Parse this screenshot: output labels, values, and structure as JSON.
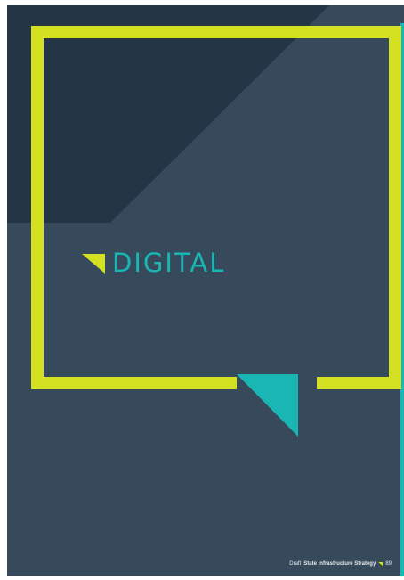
{
  "cover": {
    "section_title": "DIGITAL",
    "colors": {
      "background": "#364a5b",
      "dark_panel": "#243546",
      "frame": "#d4e022",
      "accent": "#19b6b4",
      "edge_strip": "#19b6b4"
    }
  },
  "footer": {
    "prefix": "Draft",
    "document_title": "State Infrastructure Strategy",
    "page_number": "89"
  },
  "icons": {
    "heading_marker": "triangle-marker-icon",
    "footer_marker": "triangle-marker-icon"
  }
}
